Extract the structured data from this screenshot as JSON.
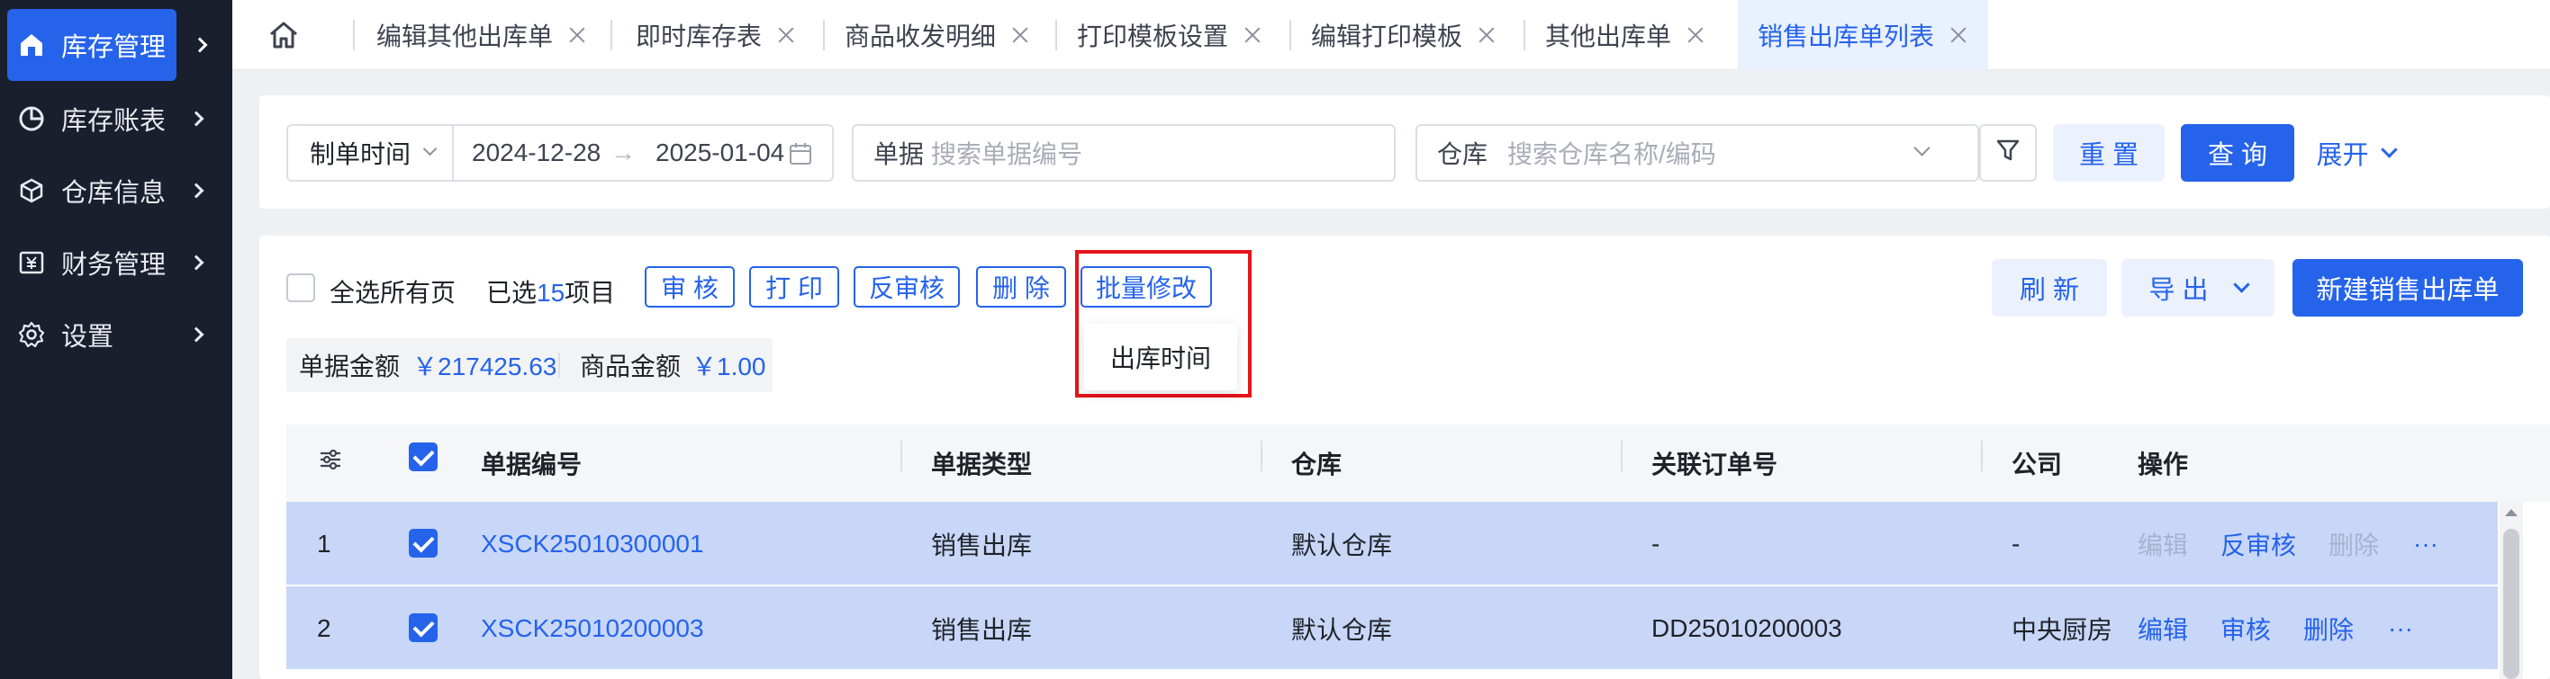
{
  "sidebar": {
    "items": [
      {
        "label": "库存管理",
        "icon": "home-icon",
        "active": true
      },
      {
        "label": "库存账表",
        "icon": "pie-chart-icon"
      },
      {
        "label": "仓库信息",
        "icon": "cube-icon"
      },
      {
        "label": "财务管理",
        "icon": "yen-icon"
      },
      {
        "label": "设置",
        "icon": "gear-icon"
      }
    ]
  },
  "tabs": [
    {
      "label": "编辑其他出库单"
    },
    {
      "label": "即时库存表"
    },
    {
      "label": "商品收发明细"
    },
    {
      "label": "打印模板设置"
    },
    {
      "label": "编辑打印模板"
    },
    {
      "label": "其他出库单"
    },
    {
      "label": "销售出库单列表",
      "active": true
    }
  ],
  "filters": {
    "date_type": "制单时间",
    "date_start": "2024-12-28",
    "date_end": "2025-01-04",
    "doc_label": "单据",
    "doc_placeholder": "搜索单据编号",
    "warehouse_label": "仓库",
    "warehouse_placeholder": "搜索仓库名称/编码",
    "reset": "重 置",
    "query": "查 询",
    "expand": "展开"
  },
  "toolbar": {
    "select_all": "全选所有页",
    "selected_prefix": "已选",
    "selected_count": "15",
    "selected_suffix": "项目",
    "approve": "审 核",
    "print": "打 印",
    "unapprove": "反审核",
    "delete": "删 除",
    "batch_edit": "批量修改",
    "batch_option": "出库时间",
    "refresh": "刷 新",
    "export": "导 出",
    "new": "新建销售出库单"
  },
  "summary": {
    "doc_amount_label": "单据金额",
    "doc_amount": "￥217425.63",
    "goods_amount_label": "商品金额",
    "goods_amount": "￥1.00"
  },
  "table": {
    "columns": [
      "单据编号",
      "单据类型",
      "仓库",
      "关联订单号",
      "公司",
      "操作"
    ],
    "rows": [
      {
        "index": "1",
        "code": "XSCK25010300001",
        "type": "销售出库",
        "warehouse": "默认仓库",
        "order": "-",
        "company": "-",
        "actions": [
          "编辑",
          "反审核",
          "删除",
          "···"
        ]
      },
      {
        "index": "2",
        "code": "XSCK25010200003",
        "type": "销售出库",
        "warehouse": "默认仓库",
        "order": "DD25010200003",
        "company": "中央厨房",
        "actions": [
          "编辑",
          "审核",
          "删除",
          "···"
        ]
      }
    ]
  },
  "colors": {
    "primary": "#2563eb",
    "sidebar": "#1a1f2e",
    "selected_row": "#c8d7f8",
    "highlight": "#e5141b"
  }
}
